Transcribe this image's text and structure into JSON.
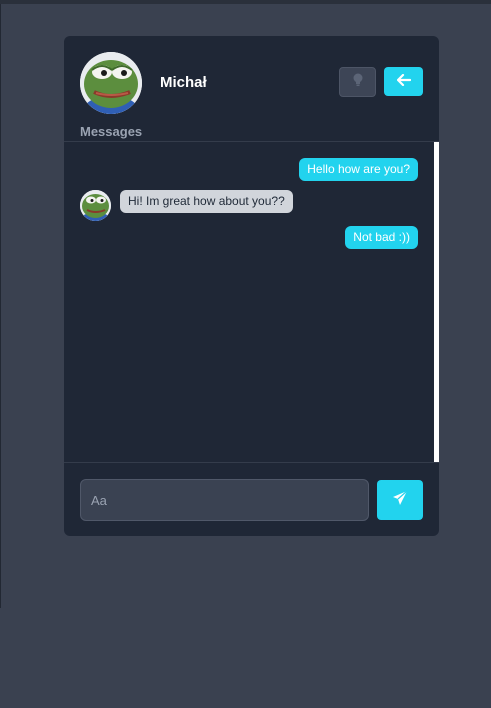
{
  "header": {
    "user_name": "Michał",
    "section_title": "Messages",
    "buttons": {
      "theme_icon": "lightbulb-icon",
      "back_icon": "arrow-left-icon"
    }
  },
  "chat": {
    "messages": [
      {
        "direction": "outgoing",
        "text": "Hello how are you?"
      },
      {
        "direction": "incoming",
        "text": "Hi! Im great how about you??",
        "avatar": "frog-avatar"
      },
      {
        "direction": "outgoing",
        "text": "Not bad :))"
      }
    ]
  },
  "composer": {
    "placeholder": "Aa",
    "send_icon": "paper-plane-icon"
  },
  "colors": {
    "page_bg": "#3a4150",
    "card_bg": "#1f2736",
    "accent": "#22d3ee",
    "incoming_bubble": "#d1d5db"
  }
}
